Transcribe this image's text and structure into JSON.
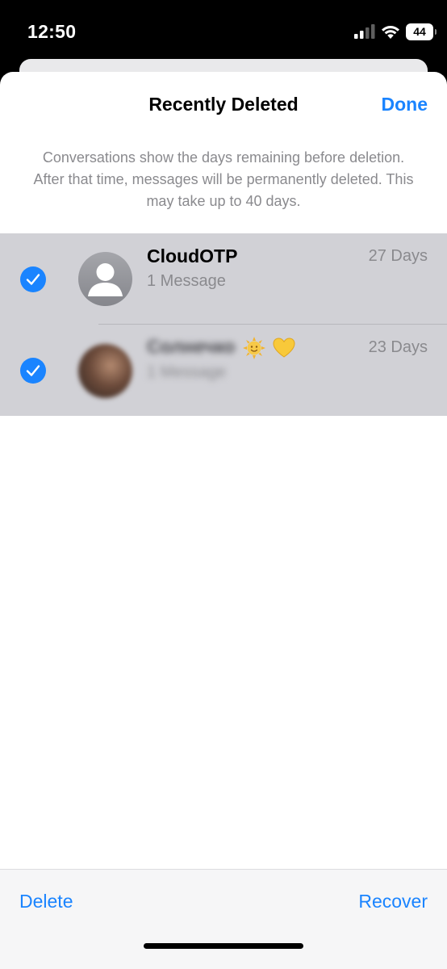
{
  "status_bar": {
    "time": "12:50",
    "battery_level": "44",
    "signal_icon": "cellular-signal-icon",
    "wifi_icon": "wifi-icon",
    "battery_icon": "battery-icon"
  },
  "header": {
    "title": "Recently Deleted",
    "done_label": "Done"
  },
  "info": {
    "text": "Conversations show the days remaining before deletion. After that time, messages will be permanently deleted. This may take up to 40 days."
  },
  "conversations": [
    {
      "name": "CloudOTP",
      "subtitle": "1 Message",
      "days": "27 Days",
      "selected": true,
      "avatar_icon": "default-contact-avatar-icon"
    },
    {
      "name": "Солнечко",
      "subtitle": "1 Message",
      "days": "23 Days",
      "selected": true,
      "name_emojis": [
        "sun-with-face-icon",
        "yellow-heart-icon"
      ],
      "blurred": true
    }
  ],
  "toolbar": {
    "delete_label": "Delete",
    "recover_label": "Recover"
  },
  "colors": {
    "accent": "#1a84ff",
    "selected_row": "#d1d1d6",
    "secondary_text": "#8a8a8e"
  }
}
